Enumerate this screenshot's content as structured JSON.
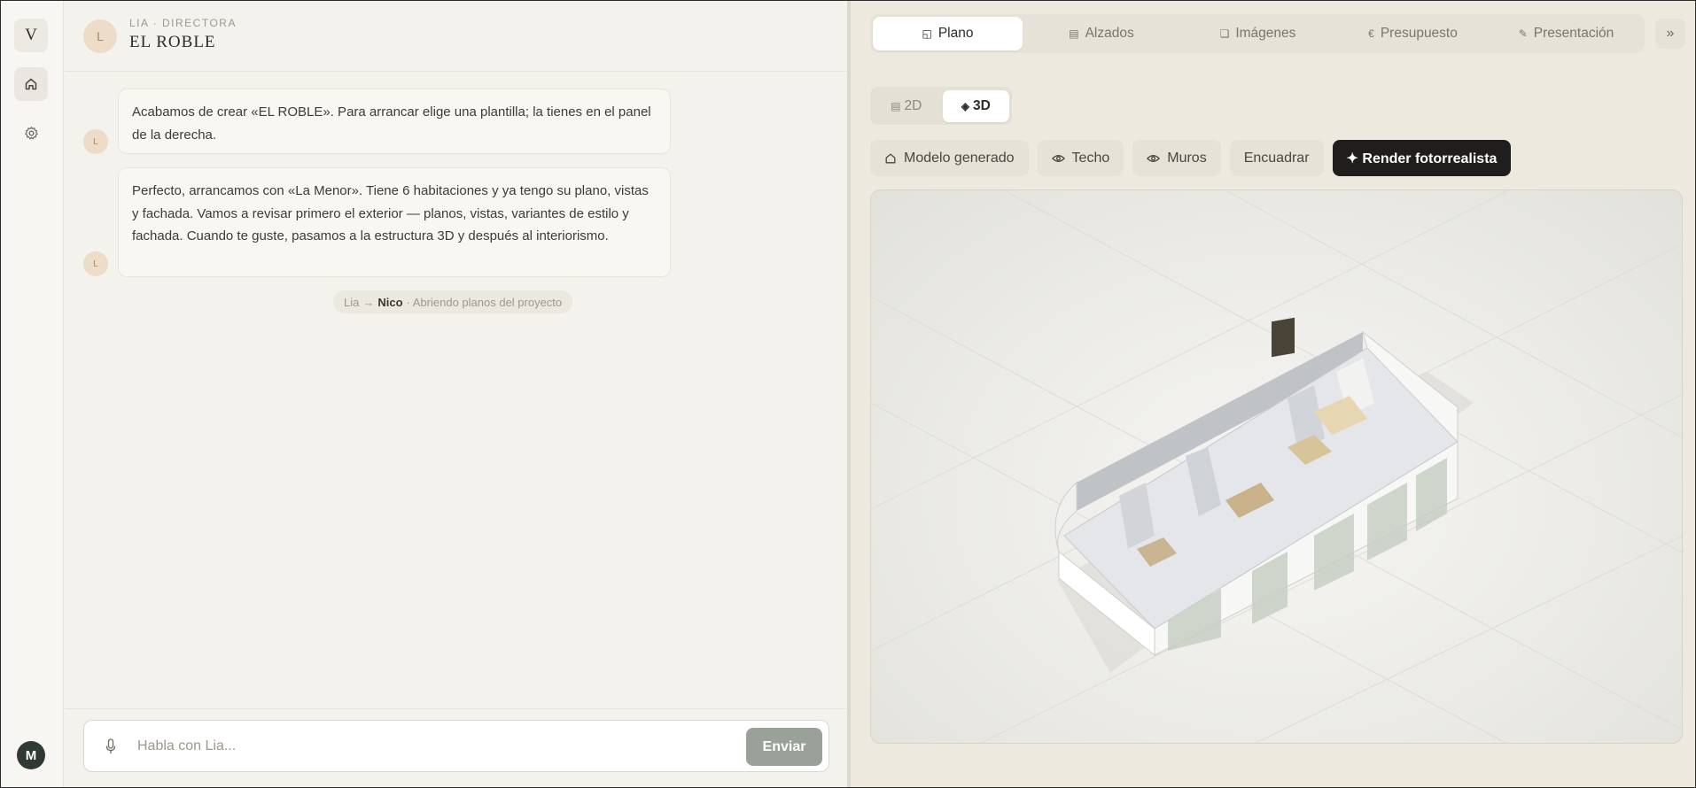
{
  "rail": {
    "logo": "V",
    "user_initial": "M"
  },
  "chat": {
    "header": {
      "avatar_initial": "L",
      "role": "LIA · DIRECTORA",
      "title": "EL ROBLE"
    },
    "messages": [
      {
        "author_initial": "L",
        "text": "Acabamos de crear «EL ROBLE». Para arrancar elige una plantilla; la tienes en el panel de la derecha."
      },
      {
        "author_initial": "L",
        "text": "Perfecto, arrancamos con «La Menor». Tiene 6 habitaciones y ya tengo su plano, vistas y fachada. Vamos a revisar primero el exterior — planos, vistas, variantes de estilo y fachada. Cuando te guste, pasamos a la estructura 3D y después al interiorismo."
      }
    ],
    "handoff": {
      "from": "Lia",
      "arrow": "→",
      "to": "Nico",
      "status": "· Abriendo planos del proyecto"
    },
    "composer": {
      "placeholder": "Habla con Lia...",
      "value": "",
      "send_label": "Enviar"
    }
  },
  "workspace": {
    "tabs": [
      {
        "label": "Plano",
        "icon": "◱",
        "active": true
      },
      {
        "label": "Alzados",
        "icon": "▤",
        "active": false
      },
      {
        "label": "Imágenes",
        "icon": "❏",
        "active": false
      },
      {
        "label": "Presupuesto",
        "icon": "€",
        "active": false
      },
      {
        "label": "Presentación",
        "icon": "✎",
        "active": false
      }
    ],
    "collapse_icon": "»",
    "view_toggle": [
      {
        "label": "2D",
        "icon": "▤",
        "active": false
      },
      {
        "label": "3D",
        "icon": "◈",
        "active": true
      }
    ],
    "tools": {
      "modelo": "Modelo generado",
      "techo": "Techo",
      "muros": "Muros",
      "encuadrar": "Encuadrar",
      "render": "✦ Render fotorrealista"
    }
  },
  "colors": {
    "accent_dark": "#1f1e1c",
    "send_button": "#9aa198",
    "avatar_beige": "#ecdcc8"
  }
}
